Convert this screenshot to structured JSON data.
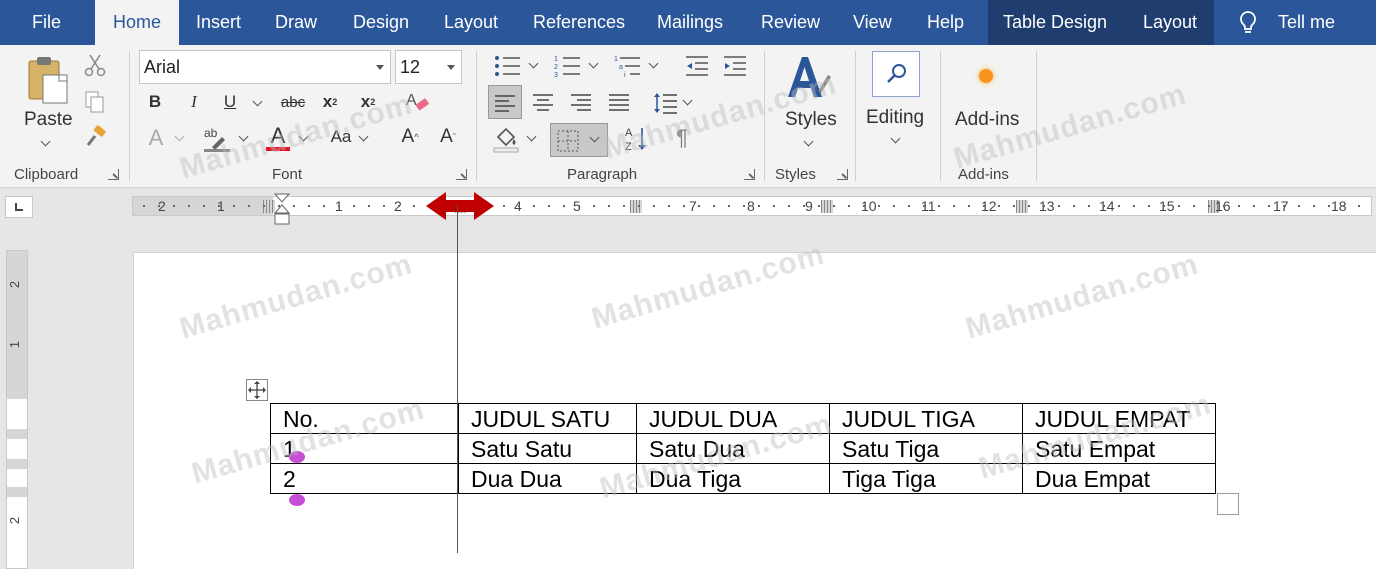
{
  "tabs": [
    "File",
    "Home",
    "Insert",
    "Draw",
    "Design",
    "Layout",
    "References",
    "Mailings",
    "Review",
    "View",
    "Help",
    "Table Design",
    "Layout"
  ],
  "active_tab": "Home",
  "tell_me": "Tell me",
  "ribbon": {
    "clipboard": {
      "paste_label": "Paste",
      "group_label": "Clipboard"
    },
    "font": {
      "font_name": "Arial",
      "font_size": "12",
      "group_label": "Font",
      "font_color": "#e81123"
    },
    "paragraph": {
      "group_label": "Paragraph"
    },
    "styles": {
      "label": "Styles",
      "group_label": "Styles"
    },
    "editing": {
      "label": "Editing"
    },
    "addins": {
      "label": "Add-ins",
      "group_label": "Add-ins"
    }
  },
  "ruler": {
    "numbers": [
      "2",
      "1",
      "1",
      "2",
      "4",
      "5",
      "7",
      "8",
      "9",
      "10",
      "11",
      "12",
      "13",
      "14",
      "15",
      "16",
      "17",
      "18"
    ]
  },
  "vruler": {
    "numbers": [
      "2",
      "1",
      "2"
    ]
  },
  "table": {
    "rows": [
      [
        "No.",
        "JUDUL SATU",
        "JUDUL DUA",
        "JUDUL TIGA",
        "JUDUL EMPAT"
      ],
      [
        "1",
        "Satu Satu",
        "Satu Dua",
        "Satu Tiga",
        "Satu Empat"
      ],
      [
        "2",
        "Dua Dua",
        "Dua Tiga",
        "Tiga Tiga",
        "Dua Empat"
      ]
    ]
  },
  "watermark": "Mahmudan.com",
  "colors": {
    "tabbar": "#2b579a",
    "context_tabs": "#1f3d6e",
    "arrow": "#c00000",
    "pin": "#c64ed4",
    "accent_orange": "#f7941d"
  }
}
